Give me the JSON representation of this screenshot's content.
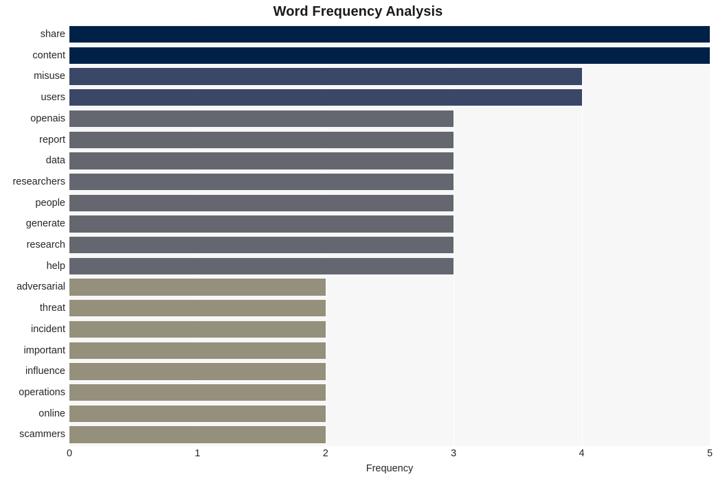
{
  "chart_data": {
    "type": "bar",
    "orientation": "horizontal",
    "title": "Word Frequency Analysis",
    "xlabel": "Frequency",
    "ylabel": "",
    "xlim": [
      0,
      5
    ],
    "xticks": [
      "0",
      "1",
      "2",
      "3",
      "4",
      "5"
    ],
    "grid": true,
    "grid_axis": "x",
    "legend": "none",
    "background": "#f7f7f7",
    "gridline_color": "#ffffff",
    "categories": [
      "share",
      "content",
      "misuse",
      "users",
      "openais",
      "report",
      "data",
      "researchers",
      "people",
      "generate",
      "research",
      "help",
      "adversarial",
      "threat",
      "incident",
      "important",
      "influence",
      "operations",
      "online",
      "scammers"
    ],
    "values": [
      5,
      5,
      4,
      4,
      3,
      3,
      3,
      3,
      3,
      3,
      3,
      3,
      2,
      2,
      2,
      2,
      2,
      2,
      2,
      2
    ],
    "bar_colors": [
      "#002147",
      "#002147",
      "#3a4767",
      "#3a4767",
      "#64676f",
      "#64676f",
      "#64676f",
      "#64676f",
      "#64676f",
      "#64676f",
      "#64676f",
      "#64676f",
      "#94907c",
      "#94907c",
      "#94907c",
      "#94907c",
      "#94907c",
      "#94907c",
      "#94907c",
      "#94907c"
    ],
    "color_groups": [
      {
        "value": 5,
        "color": "#002147"
      },
      {
        "value": 4,
        "color": "#3a4767"
      },
      {
        "value": 3,
        "color": "#64676f"
      },
      {
        "value": 2,
        "color": "#94907c"
      }
    ]
  }
}
